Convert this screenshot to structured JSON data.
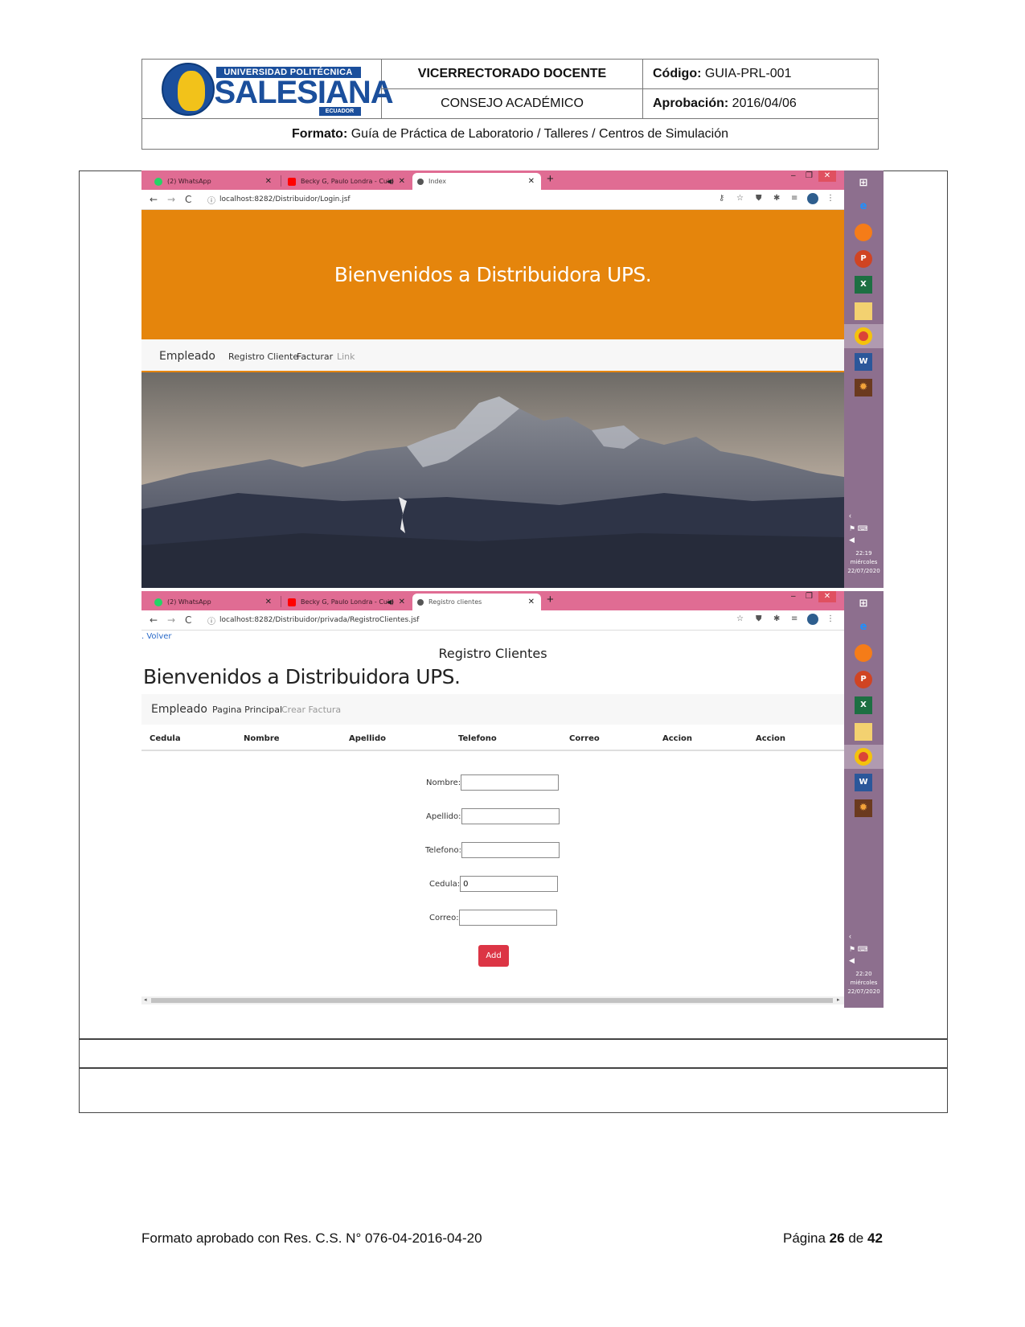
{
  "header": {
    "logo_text": "UNIVERSIDAD POLITÉCNICA SALESIANA ECUADOR",
    "dept_label": "VICERRECTORADO DOCENTE",
    "council_label": "CONSEJO ACADÉMICO",
    "codigo_key": "Código:",
    "codigo_value": "GUIA-PRL-001",
    "aprobacion_key": "Aprobación:",
    "aprobacion_value": "2016/04/06",
    "formato_key": "Formato:",
    "formato_value": "Guía de Práctica de Laboratorio / Talleres / Centros de Simulación"
  },
  "screenshot1": {
    "tabs": [
      {
        "label": "(2) WhatsApp",
        "icon": "whatsapp-icon",
        "active": false
      },
      {
        "label": "Becky G, Paulo Londra - Cuid",
        "icon": "youtube-icon",
        "active": false
      },
      {
        "label": "Index",
        "icon": "globe-icon",
        "active": true
      }
    ],
    "url": "localhost:8282/Distribuidor/Login.jsf",
    "hero_title": "Bienvenidos a Distribuidora UPS.",
    "nav": {
      "brand": "Empleado",
      "links": [
        "Registro Cliente",
        "Facturar",
        "Link"
      ]
    },
    "clock": {
      "time": "22:19",
      "day": "miércoles",
      "date": "22/07/2020"
    }
  },
  "screenshot2": {
    "tabs": [
      {
        "label": "(2) WhatsApp",
        "icon": "whatsapp-icon",
        "active": false
      },
      {
        "label": "Becky G, Paulo Londra - Cuid",
        "icon": "youtube-icon",
        "active": false
      },
      {
        "label": "Registro clientes",
        "icon": "globe-icon",
        "active": true
      }
    ],
    "url": "localhost:8282/Distribuidor/privada/RegistroClientes.jsf",
    "back_link": ". Volver",
    "section_title": "Registro Clientes",
    "page_title": "Bienvenidos a Distribuidora UPS.",
    "nav": {
      "brand": "Empleado",
      "links": [
        "Pagina Principal",
        "Crear Factura"
      ]
    },
    "table_headers": [
      "Cedula",
      "Nombre",
      "Apellido",
      "Telefono",
      "Correo",
      "Accion",
      "Accion"
    ],
    "form": {
      "nombre_label": "Nombre:",
      "nombre_value": "",
      "apellido_label": "Apellido:",
      "apellido_value": "",
      "telefono_label": "Telefono:",
      "telefono_value": "",
      "cedula_label": "Cedula:",
      "cedula_value": "0",
      "correo_label": "Correo:",
      "correo_value": "",
      "submit_label": "Add"
    },
    "clock": {
      "time": "22:20",
      "day": "miércoles",
      "date": "22/07/2020"
    }
  },
  "footer": {
    "left": "Formato aprobado con Res. C.S. N° 076-04-2016-04-20",
    "page_prefix": "Página",
    "page_current": "26",
    "page_of": "de",
    "page_total": "42"
  },
  "colors": {
    "brand_blue": "#1b4f9c",
    "tab_pink": "#e06c93",
    "hero_orange": "#e5850c",
    "taskbar_purple": "#8d6f8e",
    "add_button_red": "#dc3545"
  }
}
